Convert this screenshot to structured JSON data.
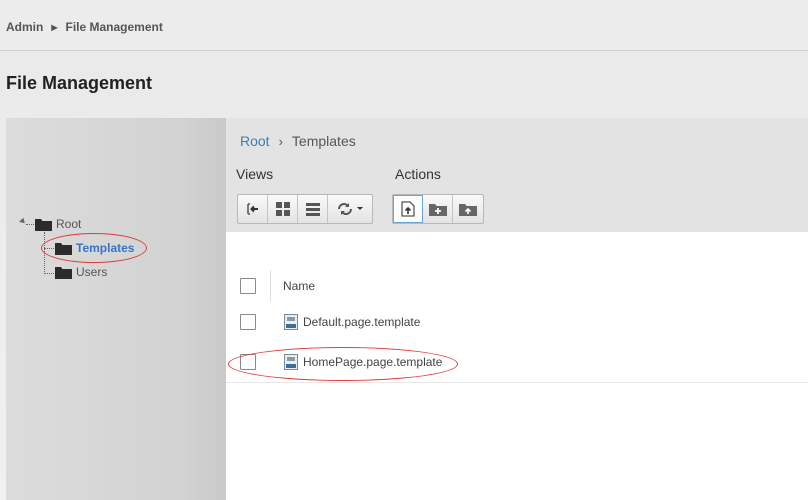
{
  "breadcrumb": {
    "root": "Admin",
    "current": "File Management"
  },
  "page": {
    "title": "File Management"
  },
  "tree": {
    "root": {
      "label": "Root"
    },
    "children": [
      {
        "label": "Templates",
        "selected": true
      },
      {
        "label": "Users",
        "selected": false
      }
    ]
  },
  "main": {
    "path": {
      "root": "Root",
      "current": "Templates"
    },
    "views_label": "Views",
    "actions_label": "Actions",
    "grid": {
      "columns": [
        "Name"
      ],
      "rows": [
        {
          "name": "Default.page.template"
        },
        {
          "name": "HomePage.page.template"
        }
      ]
    }
  },
  "colors": {
    "accent": "#3d7fb3",
    "selected_tree": "#3a73c4",
    "highlight_oval": "#e03a3a"
  },
  "icons": {
    "views": [
      "collapse-panel-icon",
      "grid-view-icon",
      "list-view-icon",
      "refresh-icon",
      "dropdown-arrow-icon"
    ],
    "actions": [
      "upload-file-icon",
      "new-folder-icon",
      "upload-folder-icon"
    ]
  }
}
